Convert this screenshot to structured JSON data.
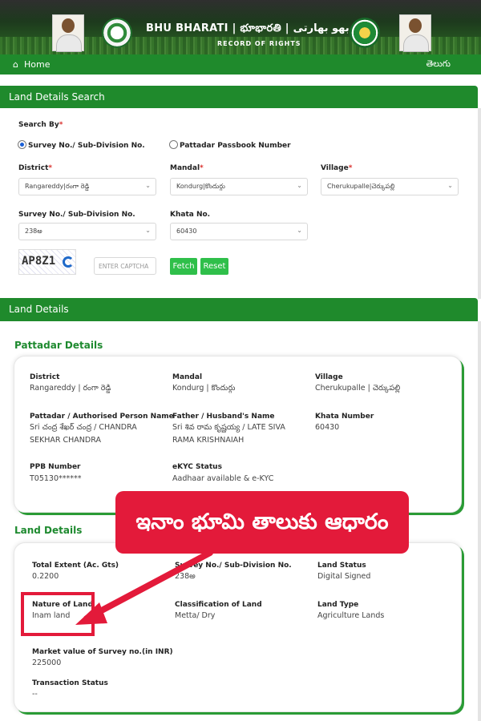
{
  "header": {
    "title": "BHU BHARATI | భూభారతి | بھو بھارتی",
    "subtitle": "RECORD OF RIGHTS"
  },
  "nav": {
    "home": "Home",
    "language": "తెలుగు"
  },
  "search": {
    "section_title": "Land Details Search",
    "search_by_label": "Search By",
    "option_survey": "Survey No./ Sub-Division No.",
    "option_passbook": "Pattadar Passbook Number",
    "district_label": "District",
    "district_value": "Rangareddy|రంగా రెడ్డి",
    "mandal_label": "Mandal",
    "mandal_value": "Kondurg|కొందుర్గు",
    "village_label": "Village",
    "village_value": "Cherukupalle|చెర్కుపల్లి",
    "survey_label": "Survey No./ Sub-Division No.",
    "survey_value": "238అ",
    "khata_label": "Khata No.",
    "khata_value": "60430",
    "captcha_text": "AP8Z1",
    "captcha_placeholder": "ENTER CAPTCHA",
    "fetch": "Fetch",
    "reset": "Reset"
  },
  "land_details_bar": "Land Details",
  "pattadar": {
    "title": "Pattadar Details",
    "district_label": "District",
    "district_value": "Rangareddy | రంగా రెడ్డి",
    "mandal_label": "Mandal",
    "mandal_value": "Kondurg | కొందుర్గు",
    "village_label": "Village",
    "village_value": "Cherukupalle | చెర్కుపల్లి",
    "person_label": "Pattadar / Authorised Person Name",
    "person_value": "Sri చంద్ర శేఖర్ చంద్ర / CHANDRA SEKHAR CHANDRA",
    "father_label": "Father / Husband's Name",
    "father_value": "Sri శివ రామ కృష్ణయ్య / LATE SIVA RAMA KRISHNAIAH",
    "khata_label": "Khata Number",
    "khata_value": "60430",
    "ppb_label": "PPB Number",
    "ppb_value": "T05130******",
    "ekyc_label": "eKYC Status",
    "ekyc_value": "Aadhaar available & e-KYC"
  },
  "land": {
    "title": "Land Details",
    "extent_label": "Total Extent (Ac. Gts)",
    "extent_value": "0.2200",
    "survey_label": "Survey No./ Sub-Division No.",
    "survey_value": "238అ",
    "status_label": "Land Status",
    "status_value": "Digital Signed",
    "nature_label": "Nature of Land",
    "nature_value": "Inam land",
    "class_label": "Classification of Land",
    "class_value": "Metta/ Dry",
    "type_label": "Land Type",
    "type_value": "Agriculture Lands",
    "market_label": "Market value of Survey no.(in INR)",
    "market_value": "225000",
    "transaction_label": "Transaction Status",
    "transaction_value": "--"
  },
  "callout": {
    "text": "ఇనాం భూమి తాలుకు ఆధారం",
    "color": "#e31a3a"
  },
  "colors": {
    "primary_green": "#1f8a2c",
    "button_green": "#2fbf4a"
  }
}
